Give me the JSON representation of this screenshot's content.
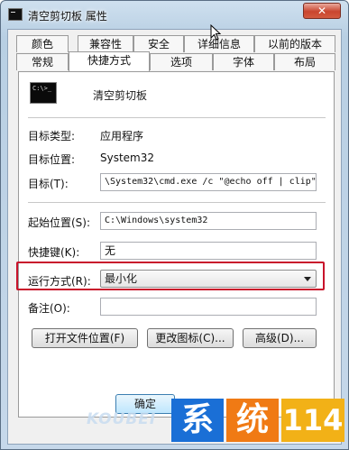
{
  "window": {
    "title": "清空剪切板 属性",
    "close_label": "✕"
  },
  "tabs": {
    "row1": [
      {
        "label": "颜色"
      },
      {
        "label": "兼容性"
      },
      {
        "label": "安全"
      },
      {
        "label": "详细信息"
      },
      {
        "label": "以前的版本"
      }
    ],
    "row2": [
      {
        "label": "常规"
      },
      {
        "label": "快捷方式",
        "active": true
      },
      {
        "label": "选项"
      },
      {
        "label": "字体"
      },
      {
        "label": "布局"
      }
    ]
  },
  "shortcut": {
    "icon": "console-icon",
    "name": "清空剪切板",
    "target_type_label": "目标类型:",
    "target_type_value": "应用程序",
    "target_location_label": "目标位置:",
    "target_location_value": "System32",
    "target_label": "目标(T):",
    "target_value": "\\System32\\cmd.exe /c \"@echo off | clip\"",
    "start_in_label": "起始位置(S):",
    "start_in_value": "C:\\Windows\\system32",
    "shortcut_key_label": "快捷键(K):",
    "shortcut_key_value": "无",
    "run_label": "运行方式(R):",
    "run_value": "最小化",
    "comment_label": "备注(O):",
    "comment_value": ""
  },
  "buttons": {
    "open_location": "打开文件位置(F)",
    "change_icon": "更改图标(C)...",
    "advanced": "高级(D)...",
    "ok": "确定"
  },
  "watermark": {
    "text": "KOUBEI",
    "chars": [
      "系",
      "统",
      "114"
    ],
    "colors": [
      "#1a6fd6",
      "#f07a14",
      "#f2b117"
    ]
  },
  "colors": {
    "highlight": "#c8132b"
  }
}
